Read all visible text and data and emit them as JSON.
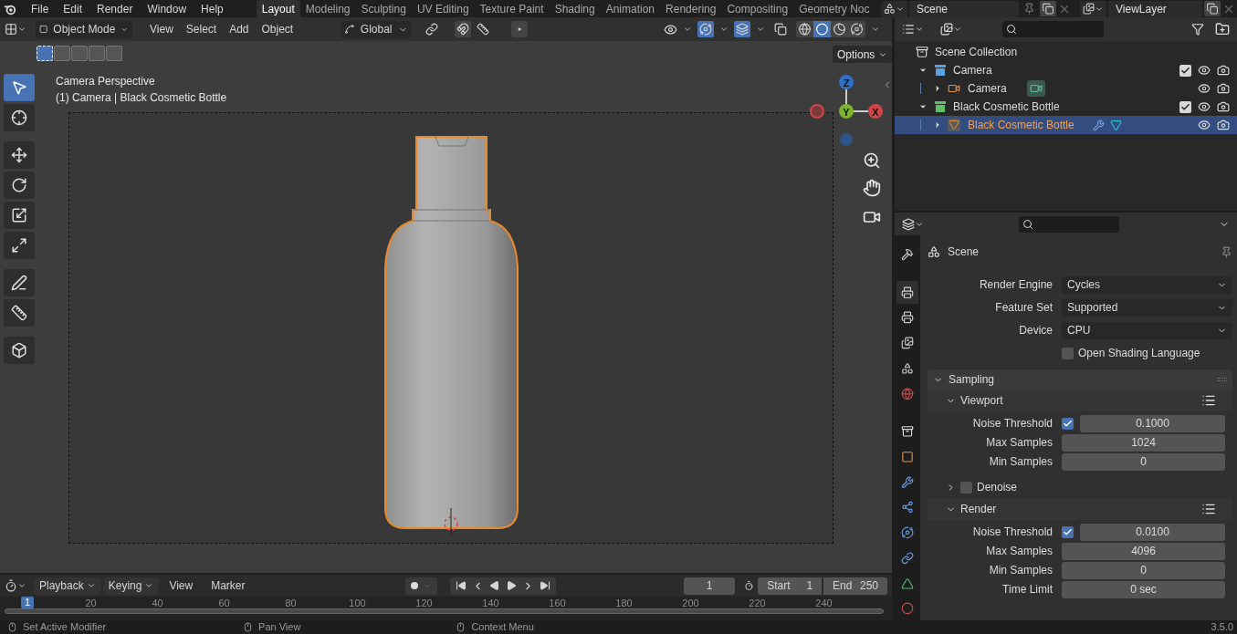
{
  "menu_bar": {
    "menus": [
      "File",
      "Edit",
      "Render",
      "Window",
      "Help"
    ],
    "workspaces": [
      {
        "label": "Layout",
        "selected": true
      },
      {
        "label": "Modeling",
        "selected": false
      },
      {
        "label": "Sculpting",
        "selected": false
      },
      {
        "label": "UV Editing",
        "selected": false
      },
      {
        "label": "Texture Paint",
        "selected": false
      },
      {
        "label": "Shading",
        "selected": false
      },
      {
        "label": "Animation",
        "selected": false
      },
      {
        "label": "Rendering",
        "selected": false
      },
      {
        "label": "Compositing",
        "selected": false
      },
      {
        "label": "Geometry Noc",
        "selected": false
      }
    ],
    "scene": "Scene",
    "view_layer": "ViewLayer"
  },
  "viewport": {
    "mode": "Object Mode",
    "menus": [
      "View",
      "Select",
      "Add",
      "Object"
    ],
    "orientation": "Global",
    "select_modes": [
      {
        "selected": true
      },
      {
        "selected": false
      },
      {
        "selected": false
      },
      {
        "selected": false
      },
      {
        "selected": false
      }
    ],
    "shading_modes": [
      {
        "selected": false
      },
      {
        "selected": true
      },
      {
        "selected": false
      },
      {
        "selected": false
      }
    ],
    "options": "Options",
    "tools": [
      {
        "selected": true
      },
      {
        "selected": false
      },
      {
        "selected": false
      },
      {
        "selected": false
      },
      {
        "selected": false
      },
      {
        "selected": false
      },
      {
        "selected": false
      },
      {
        "selected": false
      },
      {
        "selected": false
      }
    ],
    "view_name": "Camera Perspective",
    "object_info": "(1) Camera | Black Cosmetic Bottle",
    "axes": [
      "Z",
      "Y",
      "X"
    ]
  },
  "outliner": {
    "root": "Scene Collection",
    "collections": [
      {
        "label": "Camera",
        "color": "#5aa0e0",
        "expanded": true,
        "checked": true,
        "children": [
          {
            "label": "Camera",
            "kind": "camera",
            "expanded": false,
            "selected": false
          }
        ]
      },
      {
        "label": "Black Cosmetic Bottle",
        "color": "#5fbf6a",
        "expanded": true,
        "checked": true,
        "children": [
          {
            "label": "Black Cosmetic Bottle",
            "kind": "mesh",
            "expanded": false,
            "selected": true
          }
        ]
      }
    ]
  },
  "properties": {
    "tabs": [
      {
        "selected": false
      },
      {
        "selected": true
      },
      {
        "selected": false
      },
      {
        "selected": false
      },
      {
        "selected": false
      },
      {
        "selected": false
      },
      {
        "selected": false
      },
      {
        "selected": false
      },
      {
        "selected": false
      },
      {
        "selected": false
      },
      {
        "selected": false
      },
      {
        "selected": false
      },
      {
        "selected": false
      },
      {
        "selected": false
      }
    ],
    "context": "Scene",
    "fields": [
      {
        "label": "Render Engine",
        "value": "Cycles"
      },
      {
        "label": "Feature Set",
        "value": "Supported"
      },
      {
        "label": "Device",
        "value": "CPU"
      }
    ],
    "osl": {
      "label": "Open Shading Language",
      "checked": false
    },
    "panel": {
      "title": "Sampling",
      "expanded": true,
      "subpanels": [
        {
          "title": "Viewport",
          "kind": "plain",
          "expanded": true,
          "rows": [
            {
              "kind": "check_number",
              "label": "Noise Threshold",
              "checked": true,
              "value": "0.1000"
            },
            {
              "kind": "number",
              "label": "Max Samples",
              "value": "1024"
            },
            {
              "kind": "number",
              "label": "Min Samples",
              "value": "0"
            }
          ]
        },
        {
          "title": "Denoise",
          "kind": "toggle",
          "checked": false,
          "expanded": false
        },
        {
          "title": "Render",
          "kind": "plain",
          "expanded": true,
          "rows": [
            {
              "kind": "check_number",
              "label": "Noise Threshold",
              "checked": true,
              "value": "0.0100"
            },
            {
              "kind": "number",
              "label": "Max Samples",
              "value": "4096"
            },
            {
              "kind": "number",
              "label": "Min Samples",
              "value": "0"
            },
            {
              "kind": "number",
              "label": "Time Limit",
              "value": "0 sec"
            }
          ]
        }
      ]
    }
  },
  "timeline": {
    "menus": [
      {
        "label": "Playback",
        "kind": "dropdown"
      },
      {
        "label": "Keying",
        "kind": "dropdown"
      },
      {
        "label": "View",
        "kind": "plain"
      },
      {
        "label": "Marker",
        "kind": "plain"
      }
    ],
    "current_frame": "1",
    "start": {
      "label": "Start",
      "value": "1"
    },
    "end": {
      "label": "End",
      "value": "250"
    },
    "playhead": "1",
    "ruler": [
      "20",
      "40",
      "60",
      "80",
      "100",
      "120",
      "140",
      "160",
      "180",
      "200",
      "220",
      "240"
    ]
  },
  "status_bar": {
    "hints": [
      "Set Active Modifier",
      "Pan View",
      "Context Menu"
    ],
    "version": "3.5.0"
  }
}
